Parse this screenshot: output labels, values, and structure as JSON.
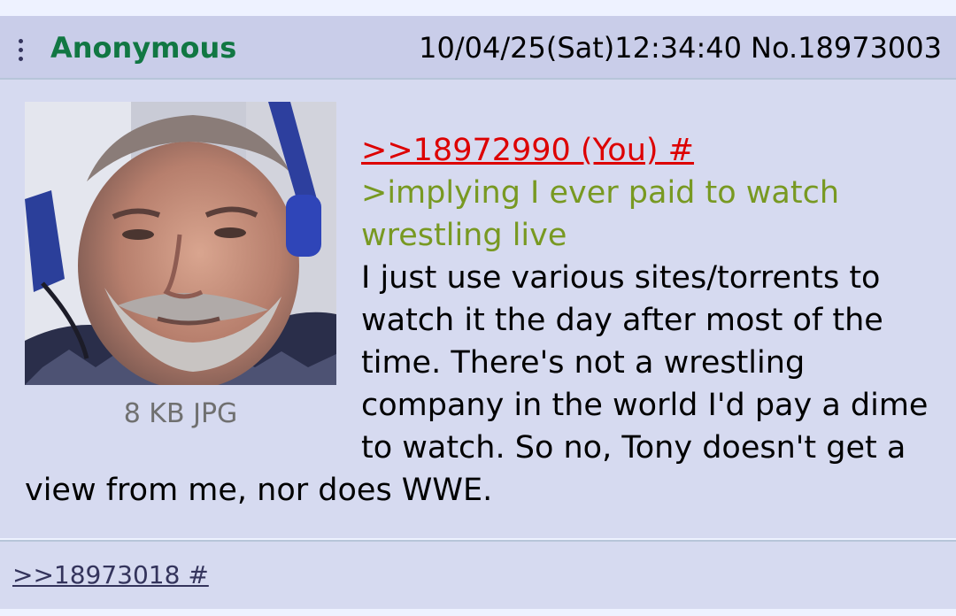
{
  "post": {
    "name": "Anonymous",
    "datetime": "10/04/25(Sat)12:34:40",
    "number": "No.18973003",
    "file": {
      "info": "8 KB JPG"
    },
    "body": {
      "quote": ">>18972990 (You) #",
      "green_1": ">implying I ever paid to watch",
      "green_2": "wrestling live",
      "text": "I just use various sites/torrents to watch it the day after most of the time. There's not a wrestling company in the world I'd pay a dime to watch. So no, Tony doesn't get a view from me, nor does WWE."
    }
  },
  "replies": {
    "backlink": ">>18973018 #"
  },
  "colors": {
    "name": "#117743",
    "quote": "#dd0000",
    "greentext": "#789922",
    "post_bg": "#d6daf0",
    "header_bg": "#c9cde9",
    "page_bg": "#eef2ff"
  },
  "icons": {
    "menu": "kebab-menu-icon"
  }
}
